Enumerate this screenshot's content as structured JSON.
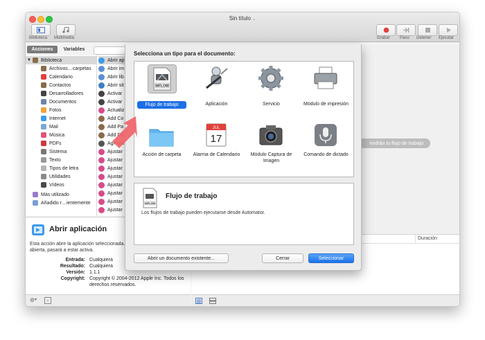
{
  "window": {
    "title": "Sin título"
  },
  "toolbar": {
    "left": [
      {
        "label": "Biblioteca",
        "icon": "library-icon"
      },
      {
        "label": "Multimedia",
        "icon": "media-icon"
      }
    ],
    "right": [
      {
        "label": "Grabar",
        "icon": "record-icon"
      },
      {
        "label": "Paso",
        "icon": "step-icon"
      },
      {
        "label": "Detener",
        "icon": "stop-icon"
      },
      {
        "label": "Ejecutar",
        "icon": "run-icon"
      }
    ]
  },
  "tabs": {
    "acciones": "Acciones",
    "variables": "Variables"
  },
  "library": {
    "root": "Biblioteca",
    "items": [
      "Archivos…carpetas",
      "Calendario",
      "Contactos",
      "Desarrolladores",
      "Documentos",
      "Fotos",
      "Internet",
      "Mail",
      "Música",
      "PDFs",
      "Sistema",
      "Texto",
      "Tipos de letra",
      "Utilidades",
      "Vídeos"
    ],
    "extra": [
      "Más utilizado",
      "Añadido r…ientemente"
    ]
  },
  "actions": [
    "Abrir ap",
    "Abrir im",
    "Abrir lib",
    "Abrir sit",
    "Activar",
    "Activar",
    "Actualiz",
    "Add Co",
    "Add Pa",
    "Add Do",
    "Agregar",
    "Ajustar",
    "Ajustar",
    "Ajustar",
    "Ajustar",
    "Ajustar",
    "Ajustar",
    "Ajustar",
    "Ajustar"
  ],
  "info": {
    "title": "Abrir aplicación",
    "description": "Esta acción abre la aplicación seleccionada. Si la aplicación ya está abierta, pasará a estar activa.",
    "entrada_label": "Entrada:",
    "entrada_value": "Cualquiera",
    "resultado_label": "Resultado:",
    "resultado_value": "Cualquiera",
    "version_label": "Versión:",
    "version_value": "1.1.1",
    "copyright_label": "Copyright:",
    "copyright_value": "Copyright © 2004-2012 Apple Inc. Todos los derechos reservados."
  },
  "workflow": {
    "hint": "endrán tu flujo de trabajo.",
    "log_duration": "Duración"
  },
  "sheet": {
    "title": "Selecciona un tipo para el documento:",
    "types": [
      {
        "label": "Flujo de trabajo",
        "selected": true
      },
      {
        "label": "Aplicación"
      },
      {
        "label": "Servicio"
      },
      {
        "label": "Módulo de impresión"
      },
      {
        "label": "Acción de carpeta"
      },
      {
        "label": "Alarma de Calendario"
      },
      {
        "label": "Módulo Captura de Imagen"
      },
      {
        "label": "Comando de dictado"
      }
    ],
    "wflow_tag": "WFLOW",
    "calendar_month": "JUL",
    "calendar_day": "17",
    "desc_title": "Flujo de trabajo",
    "desc_text": "Los flujos de trabajo pueden ejecutarse desde Automator.",
    "open_existing": "Abrir un documento existente...",
    "cancel": "Cerrar",
    "choose": "Seleccionar"
  },
  "colors": {
    "accent": "#1d6fe6",
    "arrow": "#f0646a"
  }
}
